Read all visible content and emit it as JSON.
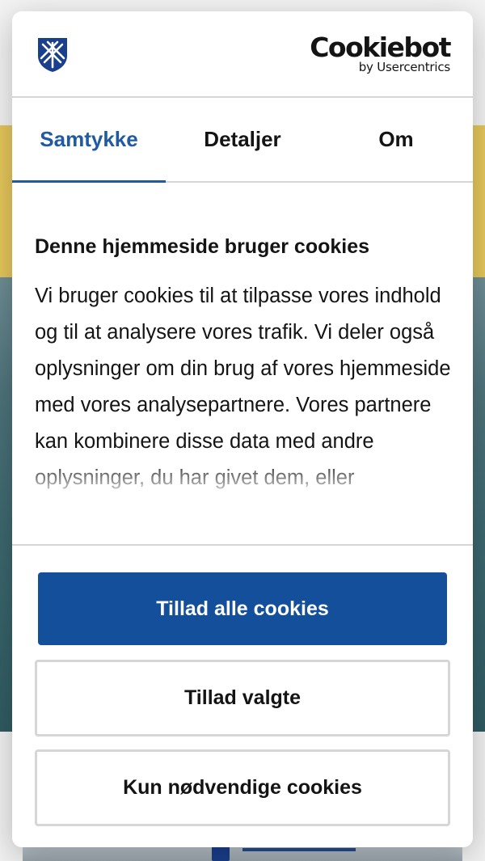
{
  "brand": {
    "name": "Cookiebot",
    "sub": "by Usercentrics"
  },
  "tabs": [
    {
      "label": "Samtykke",
      "active": true
    },
    {
      "label": "Detaljer",
      "active": false
    },
    {
      "label": "Om",
      "active": false
    }
  ],
  "content": {
    "title": "Denne hjemmeside bruger cookies",
    "body": "Vi bruger cookies til at tilpasse vores indhold og til at analysere vores trafik. Vi deler også oplysninger om din brug af vores hjemmeside med vores analysepartnere. Vores partnere kan kombinere disse data med andre oplysninger, du har givet dem, eller"
  },
  "buttons": {
    "allow_all": "Tillad alle cookies",
    "allow_selected": "Tillad valgte",
    "necessary_only": "Kun nødvendige cookies"
  },
  "colors": {
    "accent": "#1f5aa3",
    "primary_button": "#134f9b",
    "background_yellow": "#e6c75a",
    "logo_blue": "#1a3f8c"
  },
  "icons": {
    "site_logo": "shield-crest-icon"
  }
}
